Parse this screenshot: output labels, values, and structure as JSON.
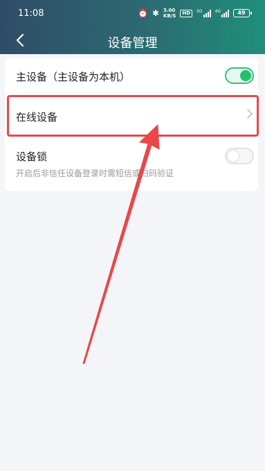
{
  "status_bar": {
    "time": "11:08",
    "speed_value": "3.00",
    "speed_unit": "KB/S",
    "hd_badge": "HD",
    "signal1_label": "5G",
    "signal2_label": "4G",
    "battery": "49"
  },
  "nav": {
    "title": "设备管理"
  },
  "settings": {
    "primary_device_label": "主设备（主设备为本机）",
    "primary_device_on": true,
    "online_devices_label": "在线设备",
    "device_lock_label": "设备锁",
    "device_lock_on": false,
    "device_lock_hint": "开启后非信任设备登录时需短信或扫码验证"
  },
  "colors": {
    "header_gradient_start": "#2f4c66",
    "header_gradient_end": "#1f8f7a",
    "toggle_on": "#24c06f",
    "highlight_red": "#e9474a"
  }
}
